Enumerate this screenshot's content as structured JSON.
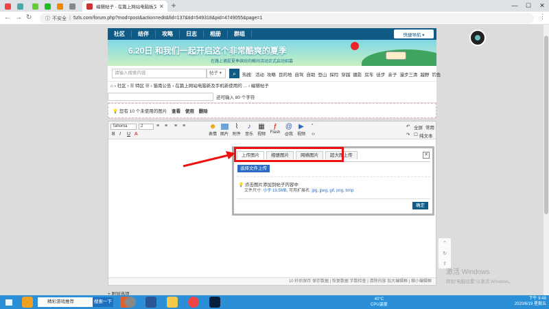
{
  "browser": {
    "active_tab_title": "编辑帖子 - 在篇上网站电脑板又…",
    "new_tab": "+",
    "controls": {
      "minimize": "—",
      "maximize": "☐",
      "close": "✕"
    },
    "insecure_label": "不安全",
    "url": "5zls.com/forum.php?mod=post&action=edit&fid=137&tid=549318&pid=4749055&page=1"
  },
  "site": {
    "nav": [
      "社区",
      "结伴",
      "攻略",
      "日志",
      "相册",
      "群组"
    ],
    "quick_nav": "快捷导航 ▾",
    "banner_title": "6.20日 和我们一起开启这个非常酷爽的夏季",
    "banner_sub": "在路上捕捉夏季缤纷的瞬间活动正式启动招募",
    "search_placeholder": "请输入搜索内容",
    "search_select": "帖子 ▾",
    "hot_label": "热搜:",
    "hot_words": [
      "活动",
      "攻略",
      "目的地",
      "自驾",
      "自助",
      "登山",
      "探险",
      "穿越",
      "摄影",
      "房车",
      "徒步",
      "亲子",
      "漫步三清",
      "越野",
      "钓鱼"
    ]
  },
  "breadcrumb": "⌂ › 社区 › ☰ 特区 ☰ › 猫南公告 › 在篇上网站电脑新及手机新使用的 ... › 编辑帖子",
  "title_hint": "还可输入 80 个字符",
  "unused_images": {
    "text": "您有 10 个未使用的图片",
    "view": "查看",
    "use": "使用",
    "delete": "删除"
  },
  "editor": {
    "font": "Tahoma",
    "size": "2",
    "tools": [
      "表情",
      "图片",
      "附件",
      "音乐",
      "视频",
      "Flash",
      "@我",
      "视频"
    ],
    "right_tools": {
      "fullscreen": "全屏",
      "common": "常用",
      "plaintext": "纯文本"
    },
    "status": "10 秒后保存  保存数据 | 恢复数据   字数检查 | 清除内容   加大编辑框 | 缩小编辑框"
  },
  "below_editor": "+ 附加选项",
  "dialog": {
    "tabs": [
      "上传图片",
      "相册图片",
      "网络图片",
      "超大图上传"
    ],
    "upload_button": "选择文件上传",
    "tip": "点击图片添加到帖子内容中",
    "size_prefix": "文件尺寸: ",
    "size_value": "小于 19.5MB",
    "ext_prefix": ", 可用扩展名: ",
    "ext_value": "jpg, jpeg, gif, png, bmp",
    "confirm": "确定",
    "close": "✕"
  },
  "watermark": {
    "line1": "激活 Windows",
    "line2": "转到\"电脑设置\"以激活 Windows。"
  },
  "taskbar": {
    "search_text": "精彩游戏推荐",
    "search_button": "搜索一下",
    "temp": "40°C",
    "temp_label": "CPU温度",
    "time": "下午 9:48",
    "date": "2020/6/19 星期五"
  },
  "colors": {
    "nav": "#0f5b85",
    "highlight": "#e11",
    "accent": "#2e6ac1"
  }
}
